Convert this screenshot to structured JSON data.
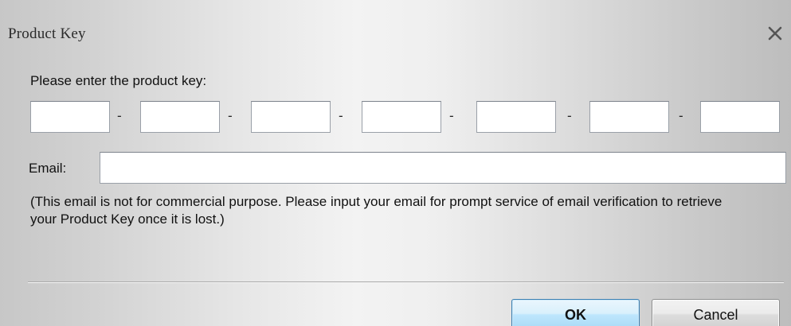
{
  "window": {
    "title": "Product Key",
    "close_icon": "close-icon"
  },
  "form": {
    "prompt": "Please enter the product key:",
    "key_separator": "-",
    "key_segments": [
      "",
      "",
      "",
      "",
      "",
      "",
      ""
    ],
    "email_label": "Email:",
    "email_value": "",
    "note": "(This email is not for commercial purpose. Please input your email for prompt service of email verification to retrieve your Product Key once it is lost.)"
  },
  "buttons": {
    "ok": "OK",
    "cancel": "Cancel"
  },
  "colors": {
    "ok_border": "#3c7fb1",
    "ok_fill": "#bee6fd",
    "dialog_background": "#e6e6e6"
  }
}
